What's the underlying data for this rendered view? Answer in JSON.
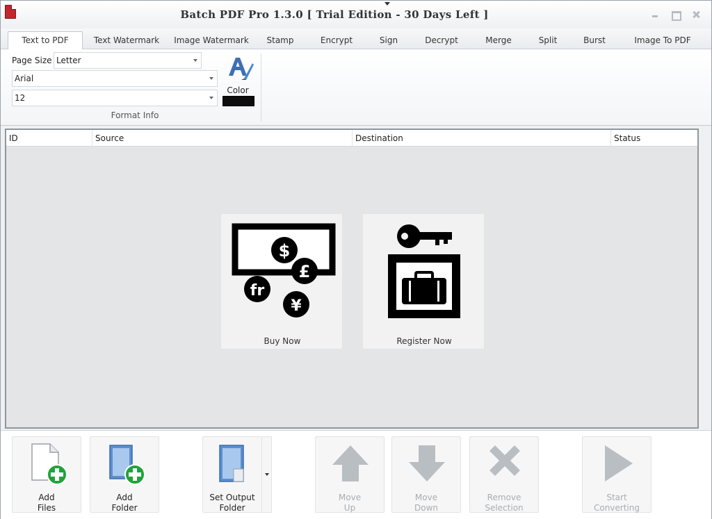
{
  "window": {
    "title": "Batch PDF Pro 1.3.0 [ Trial Edition - 30 Days Left ]"
  },
  "tabs": [
    {
      "label": "Text to PDF",
      "active": true
    },
    {
      "label": "Text Watermark"
    },
    {
      "label": "Image Watermark"
    },
    {
      "label": "Stamp"
    },
    {
      "label": "Encrypt"
    },
    {
      "label": "Sign"
    },
    {
      "label": "Decrypt"
    },
    {
      "label": "Merge"
    },
    {
      "label": "Split"
    },
    {
      "label": "Burst"
    },
    {
      "label": "Image To PDF"
    }
  ],
  "ribbon": {
    "page_size_label": "Page Size",
    "page_size_value": "Letter",
    "font_value": "Arial",
    "font_size_value": "12",
    "color_label": "Color",
    "color_value": "#0d0d0d",
    "group_label": "Format Info"
  },
  "list": {
    "columns": [
      "ID",
      "Source",
      "Destination",
      "Status"
    ]
  },
  "tiles": {
    "buy_label": "Buy Now",
    "register_label": "Register Now"
  },
  "toolbar": {
    "add_files": "Add\nFiles",
    "add_folder": "Add\nFolder",
    "set_output": "Set Output\nFolder",
    "move_up": "Move\nUp",
    "move_down": "Move\nDown",
    "remove": "Remove\nSelection",
    "start": "Start\nConverting"
  },
  "colors": {
    "accent_green": "#1fa33a",
    "disabled_gray": "#b9bec3"
  }
}
